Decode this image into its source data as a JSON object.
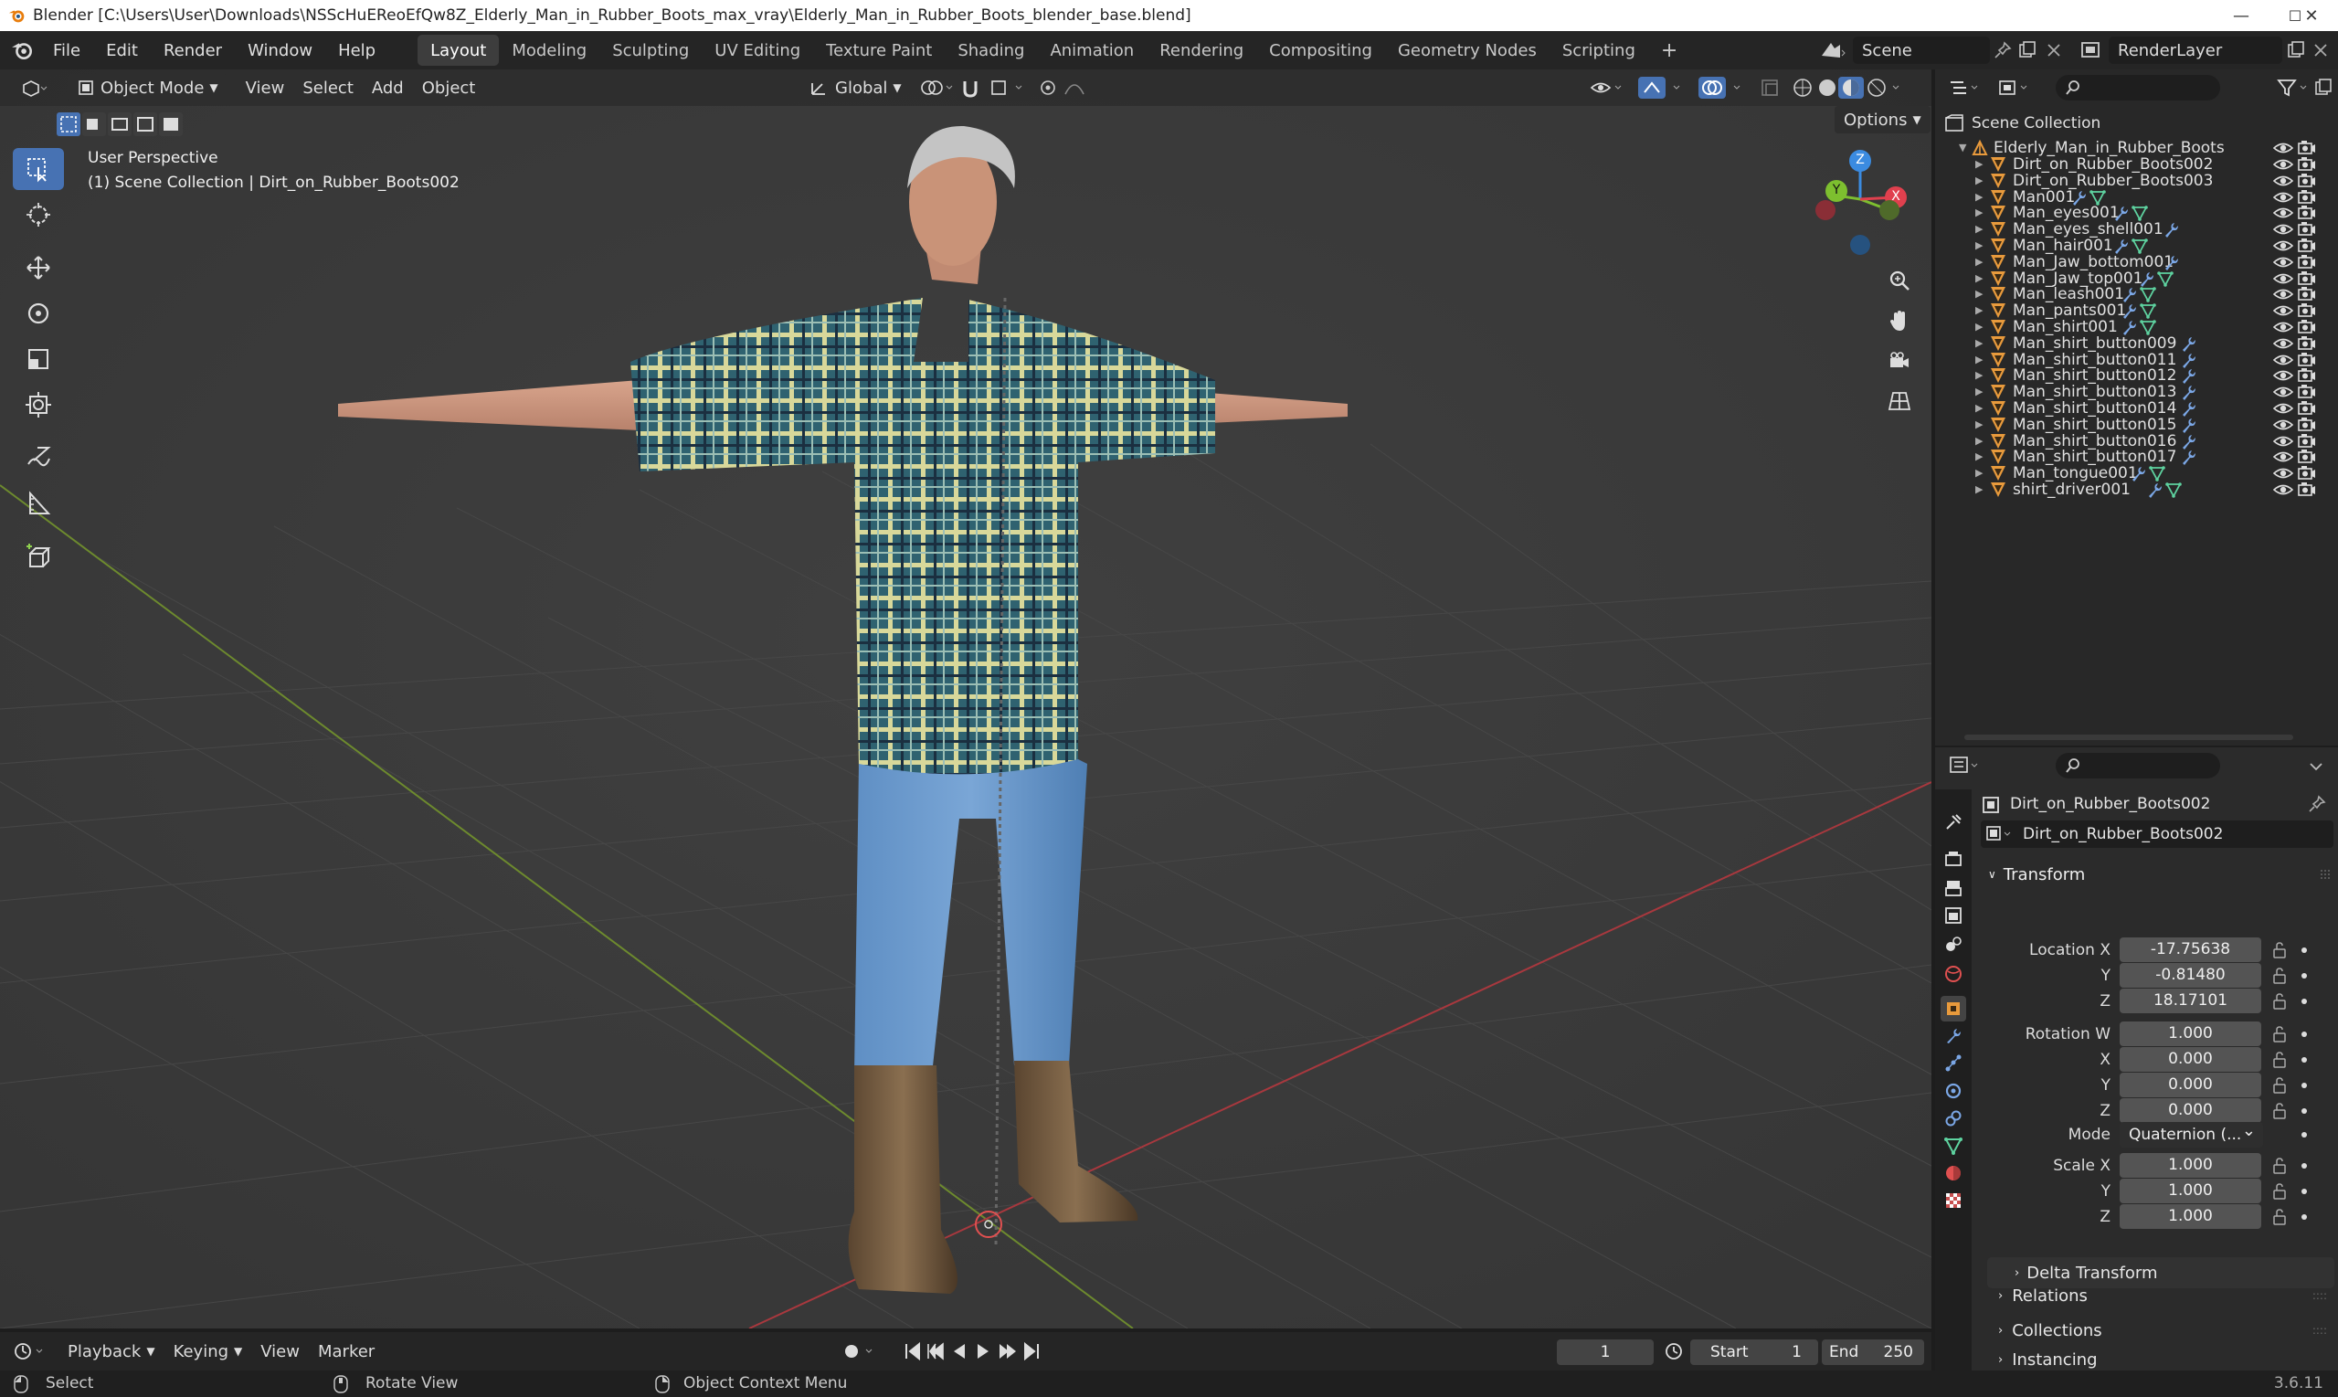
{
  "window": {
    "title": "Blender [C:\\Users\\User\\Downloads\\NSScHuEReoEfQw8Z_Elderly_Man_in_Rubber_Boots_max_vray\\Elderly_Man_in_Rubber_Boots_blender_base.blend]",
    "minimize": "—",
    "maximize": "☐",
    "close": "✕"
  },
  "menubar": {
    "items": [
      "File",
      "Edit",
      "Render",
      "Window",
      "Help"
    ],
    "workspaces": [
      "Layout",
      "Modeling",
      "Sculpting",
      "UV Editing",
      "Texture Paint",
      "Shading",
      "Animation",
      "Rendering",
      "Compositing",
      "Geometry Nodes",
      "Scripting"
    ],
    "active_workspace": "Layout",
    "add_workspace": "+",
    "scene": "Scene",
    "render_layer": "RenderLayer"
  },
  "viewport": {
    "mode": "Object Mode",
    "menus": [
      "View",
      "Select",
      "Add",
      "Object"
    ],
    "orientation": "Global",
    "options": "Options",
    "info_line1": "User Perspective",
    "info_line2": "(1) Scene Collection | Dirt_on_Rubber_Boots002",
    "gizmo_axes": [
      "Z",
      "Y",
      "X"
    ]
  },
  "outliner": {
    "root": "Scene Collection",
    "collection": "Elderly_Man_in_Rubber_Boots",
    "objects": [
      {
        "name": "Dirt_on_Rubber_Boots002",
        "icons": []
      },
      {
        "name": "Dirt_on_Rubber_Boots003",
        "icons": []
      },
      {
        "name": "Man001",
        "icons": [
          "wrench",
          "mesh"
        ]
      },
      {
        "name": "Man_eyes001",
        "icons": [
          "wrench",
          "mesh"
        ]
      },
      {
        "name": "Man_eyes_shell001",
        "icons": [
          "wrench"
        ]
      },
      {
        "name": "Man_hair001",
        "icons": [
          "wrench",
          "mesh"
        ]
      },
      {
        "name": "Man_Jaw_bottom001",
        "icons": [
          "wrench"
        ]
      },
      {
        "name": "Man_Jaw_top001",
        "icons": [
          "wrench",
          "mesh"
        ]
      },
      {
        "name": "Man_leash001",
        "icons": [
          "wrench",
          "mesh"
        ]
      },
      {
        "name": "Man_pants001",
        "icons": [
          "wrench",
          "mesh"
        ]
      },
      {
        "name": "Man_shirt001",
        "icons": [
          "wrench",
          "mesh"
        ]
      },
      {
        "name": "Man_shirt_button009",
        "icons": [
          "wrench"
        ]
      },
      {
        "name": "Man_shirt_button011",
        "icons": [
          "wrench"
        ]
      },
      {
        "name": "Man_shirt_button012",
        "icons": [
          "wrench"
        ]
      },
      {
        "name": "Man_shirt_button013",
        "icons": [
          "wrench"
        ]
      },
      {
        "name": "Man_shirt_button014",
        "icons": [
          "wrench"
        ]
      },
      {
        "name": "Man_shirt_button015",
        "icons": [
          "wrench"
        ]
      },
      {
        "name": "Man_shirt_button016",
        "icons": [
          "wrench"
        ]
      },
      {
        "name": "Man_shirt_button017",
        "icons": [
          "wrench"
        ]
      },
      {
        "name": "Man_tongue001",
        "icons": [
          "wrench",
          "mesh"
        ]
      },
      {
        "name": "shirt_driver001",
        "icons": [
          "wrench",
          "mesh"
        ]
      }
    ]
  },
  "properties": {
    "object_name": "Dirt_on_Rubber_Boots002",
    "data_name": "Dirt_on_Rubber_Boots002",
    "transform_title": "Transform",
    "location_label": "Location X",
    "location": {
      "x": "-17.75638",
      "y": "-0.81480",
      "z": "18.17101"
    },
    "rotation_label": "Rotation W",
    "rotation": {
      "w": "1.000",
      "x": "0.000",
      "y": "0.000",
      "z": "0.000"
    },
    "mode_label": "Mode",
    "mode_value": "Quaternion (...",
    "scale_label": "Scale X",
    "scale": {
      "x": "1.000",
      "y": "1.000",
      "z": "1.000"
    },
    "axis_y": "Y",
    "axis_z": "Z",
    "axis_x": "X",
    "delta_transform": "Delta Transform",
    "relations": "Relations",
    "collections": "Collections",
    "instancing": "Instancing"
  },
  "timeline": {
    "menus": [
      "Playback",
      "Keying",
      "View",
      "Marker"
    ],
    "current_frame": "1",
    "start_label": "Start",
    "start": "1",
    "end_label": "End",
    "end": "250"
  },
  "statusbar": {
    "select": "Select",
    "rotate": "Rotate View",
    "context": "Object Context Menu",
    "version": "3.6.11"
  },
  "colors": {
    "accent": "#4772b3",
    "axis_x": "#e0404e",
    "axis_y": "#7dbf2f",
    "axis_z": "#3b8be0",
    "orange_object": "#e89a3c"
  }
}
